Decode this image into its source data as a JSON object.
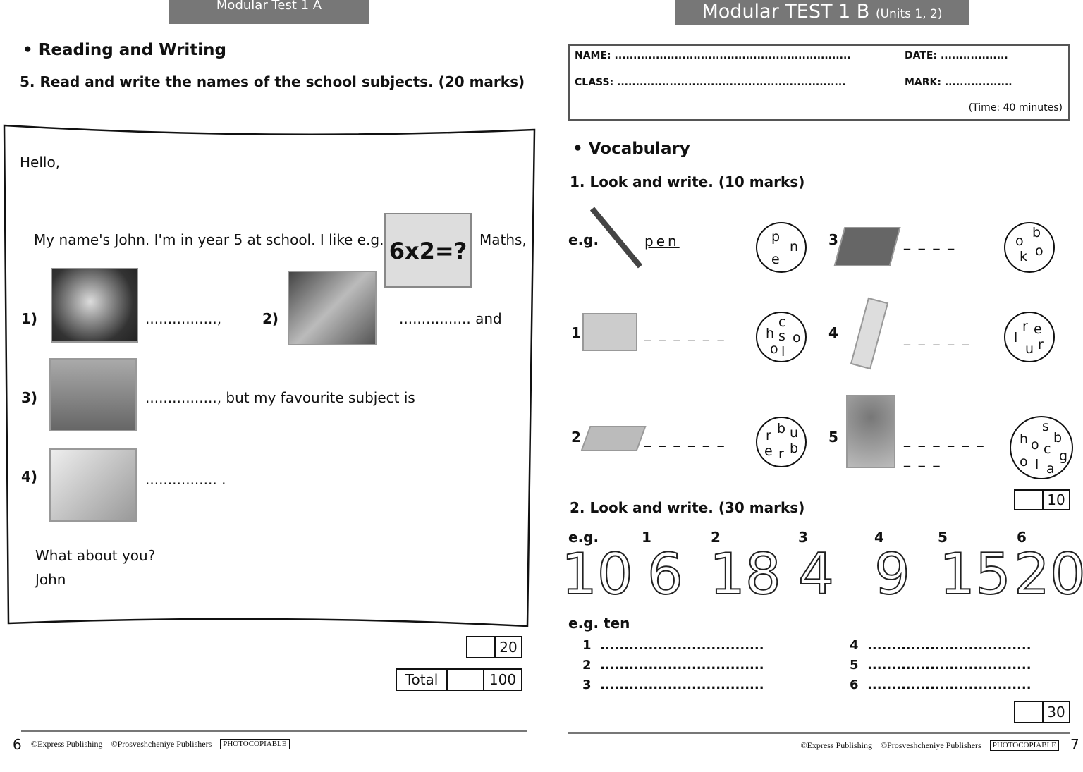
{
  "left": {
    "header": "Modular  Test 1 A",
    "section": "Reading and Writing",
    "task": "5. Read and write the names of the school subjects. (20 marks)",
    "letter": {
      "greeting": "Hello,",
      "intro": "My name's John. I'm in year 5 at school. I like e.g.",
      "eg_image_text": "6x2=?",
      "maths": "Maths,",
      "l1": "1)",
      "d1": "................,",
      "l2": "2)",
      "d2": "................ and",
      "l3": "3)",
      "d3": "................, but my favourite subject is",
      "l4": "4)",
      "d4": "................ .",
      "question": "What about you?",
      "sign": "John"
    },
    "score_box": "20",
    "total_label": "Total",
    "total": "100",
    "page": "6",
    "copyright1": "©Express Publishing",
    "copyright2": "©Prosveshcheniye Publishers",
    "photocopiable": "PHOTOCOPIABLE"
  },
  "right": {
    "header_main": "Modular TEST 1 B",
    "header_units": "(Units 1, 2)",
    "form": {
      "name": "NAME: ...............................................................",
      "date": "DATE: ..................",
      "class": "CLASS: .............................................................",
      "mark": "MARK: ..................",
      "time": "(Time: 40 minutes)"
    },
    "section": "Vocabulary",
    "task1": "1. Look and write. (10 marks)",
    "eg": "e.g.",
    "eg_answer": "pen",
    "items": [
      {
        "n": "1",
        "dash": "_ _ _ _ _ _",
        "letters": [
          "c",
          "h",
          "s",
          "o",
          "o",
          "l"
        ]
      },
      {
        "n": "2",
        "dash": "_ _ _ _ _ _",
        "letters": [
          "b",
          "r",
          "u",
          "e",
          "r",
          "b"
        ]
      },
      {
        "n": "3",
        "dash": "_ _ _ _",
        "letters": [
          "b",
          "o",
          "o",
          "k"
        ]
      },
      {
        "n": "4",
        "dash": "_ _ _ _ _",
        "letters": [
          "r",
          "e",
          "l",
          "r",
          "u"
        ]
      },
      {
        "n": "5",
        "dash": "_ _ _ _ _ _",
        "dash2": "_ _ _",
        "letters": [
          "s",
          "h",
          "o",
          "b",
          "c",
          "g",
          "o",
          "l",
          "a"
        ]
      }
    ],
    "eg_letters": [
      "p",
      "n",
      "e"
    ],
    "score1": "10",
    "task2": "2. Look and write. (30 marks)",
    "num_labels": [
      "e.g.",
      "1",
      "2",
      "3",
      "4",
      "5",
      "6"
    ],
    "numbers": [
      "10",
      "6",
      "18",
      "4",
      "9",
      "15",
      "20"
    ],
    "eg_word": "e.g. ten",
    "lines": [
      "1",
      "2",
      "3",
      "4",
      "5",
      "6"
    ],
    "dots": "..................................",
    "score2": "30",
    "page": "7",
    "copyright1": "©Express Publishing",
    "copyright2": "©Prosveshcheniye Publishers",
    "photocopiable": "PHOTOCOPIABLE"
  }
}
